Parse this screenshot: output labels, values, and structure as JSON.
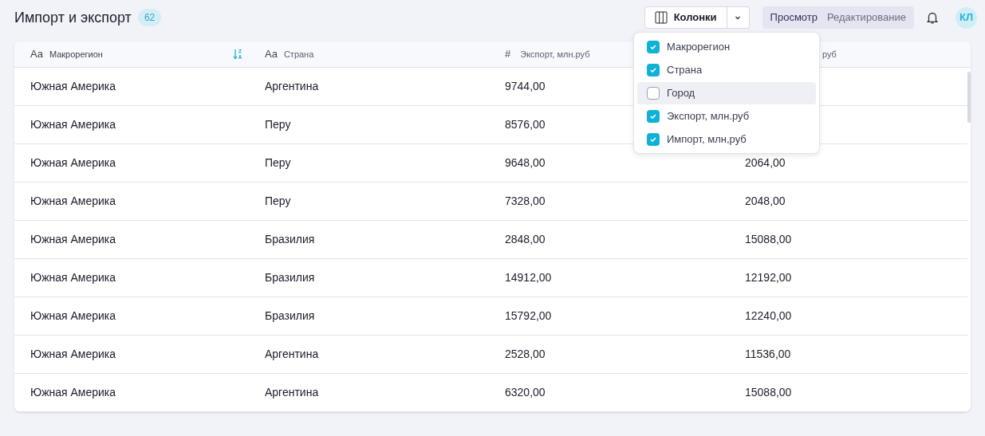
{
  "header": {
    "title": "Импорт и экспорт",
    "count": "62"
  },
  "columns_button": {
    "label": "Колонки"
  },
  "mode_tabs": [
    {
      "label": "Просмотр",
      "selected": true
    },
    {
      "label": "Редактирование",
      "selected": false
    }
  ],
  "avatar": {
    "initials": "КЛ"
  },
  "columns_menu": [
    {
      "label": "Макрорегион",
      "checked": true,
      "highlighted": false
    },
    {
      "label": "Страна",
      "checked": true,
      "highlighted": false
    },
    {
      "label": "Город",
      "checked": false,
      "highlighted": true
    },
    {
      "label": "Экспорт, млн.руб",
      "checked": true,
      "highlighted": false
    },
    {
      "label": "Импорт, млн,руб",
      "checked": true,
      "highlighted": false
    }
  ],
  "table": {
    "columns": [
      {
        "kind": "text",
        "type_icon": "Aa",
        "label": "Макрорегион",
        "sorted": true
      },
      {
        "kind": "text",
        "type_icon": "Aa",
        "label": "Страна",
        "sorted": false
      },
      {
        "kind": "number",
        "type_icon": "#",
        "label": "Экспорт, млн.руб",
        "sorted": false
      },
      {
        "kind": "hidden",
        "label": "руб",
        "sorted": false
      }
    ],
    "rows": [
      [
        "Южная Америка",
        "Аргентина",
        "9744,00",
        ""
      ],
      [
        "Южная Америка",
        "Перу",
        "8576,00",
        ""
      ],
      [
        "Южная Америка",
        "Перу",
        "9648,00",
        "2064,00"
      ],
      [
        "Южная Америка",
        "Перу",
        "7328,00",
        "2048,00"
      ],
      [
        "Южная Америка",
        "Бразилия",
        "2848,00",
        "15088,00"
      ],
      [
        "Южная Америка",
        "Бразилия",
        "14912,00",
        "12192,00"
      ],
      [
        "Южная Америка",
        "Бразилия",
        "15792,00",
        "12240,00"
      ],
      [
        "Южная Америка",
        "Аргентина",
        "2528,00",
        "11536,00"
      ],
      [
        "Южная Америка",
        "Аргентина",
        "6320,00",
        "15088,00"
      ]
    ]
  }
}
